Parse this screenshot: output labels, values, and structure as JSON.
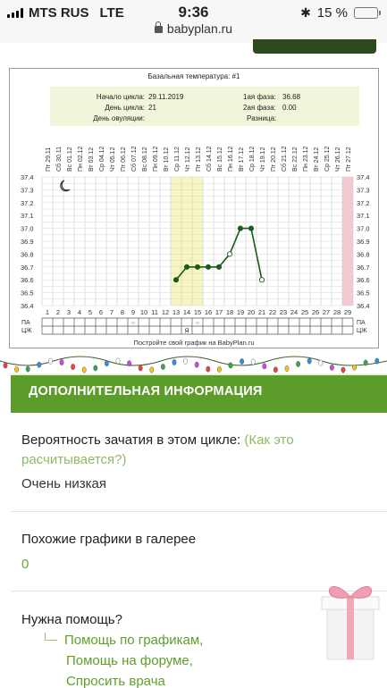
{
  "status_bar": {
    "carrier": "MTS RUS",
    "network": "LTE",
    "time": "9:36",
    "battery": "15 %",
    "battery_level": 0.15,
    "url": "babyplan.ru"
  },
  "chart_data": {
    "type": "line",
    "title": "Базальная температура: #1",
    "info": {
      "cycle_start_label": "Начало цикла:",
      "cycle_start": "29.11.2019",
      "cycle_day_label": "День цикла:",
      "cycle_day": "21",
      "ovulation_day_label": "День овуляции:",
      "ovulation_day": "",
      "phase1_label": "1ая фаза:",
      "phase1": "36.68",
      "phase2_label": "2ая фаза:",
      "phase2": "0.00",
      "difference_label": "Разница:",
      "difference": ""
    },
    "dates": [
      "Пт 29.11",
      "Сб 30.11",
      "Вс 01.12",
      "Пн 02.12",
      "Вт 03.12",
      "Ср 04.12",
      "Чт 05.12",
      "Пт 06.12",
      "Сб 07.12",
      "Вс 08.12",
      "Пн 09.12",
      "Вт 10.12",
      "Ср 11.12",
      "Чт 12.12",
      "Пт 13.12",
      "Сб 14.12",
      "Вс 15.12",
      "Пн 16.12",
      "Вт 17.12",
      "Ср 18.12",
      "Чт 19.12",
      "Пт 20.12",
      "Сб 21.12",
      "Вс 22.12",
      "Пн 23.12",
      "Вт 24.12",
      "Ср 25.12",
      "Чт 26.12",
      "Пт 27.12"
    ],
    "days": [
      1,
      2,
      3,
      4,
      5,
      6,
      7,
      8,
      9,
      10,
      11,
      12,
      13,
      14,
      15,
      16,
      17,
      18,
      19,
      20,
      21,
      22,
      23,
      24,
      25,
      26,
      27,
      28,
      29
    ],
    "y_ticks": [
      "37.4",
      "37.3",
      "37.2",
      "37.1",
      "37.0",
      "36.9",
      "36.8",
      "36.7",
      "36.6",
      "36.5",
      "36.4"
    ],
    "ylim": [
      36.4,
      37.4
    ],
    "series": [
      {
        "x": [
          13,
          14,
          15,
          16,
          17,
          18,
          19,
          20,
          21
        ],
        "values": [
          36.6,
          36.7,
          36.7,
          36.7,
          36.7,
          36.8,
          37.0,
          37.0,
          36.6
        ],
        "hollow": [
          false,
          false,
          false,
          false,
          false,
          true,
          false,
          false,
          true
        ]
      }
    ],
    "highlight_days": [
      13,
      14,
      15
    ],
    "highlight_color": "#f8f6c0",
    "end_day": 29,
    "end_color": "#f6c8cf",
    "pa_label": "ПА",
    "cj_label": "ЦЖ",
    "pa_marks": [
      {
        "day": 9,
        "mark": "○"
      },
      {
        "day": 15,
        "mark": "○"
      }
    ],
    "cj_marks": [
      {
        "day": 14,
        "mark": "Я"
      }
    ],
    "footer": "Постройте свой график на BabyPlan.ru",
    "line_color": "#1a5a1a"
  },
  "section": {
    "title": "ДОПОЛНИТЕЛЬНАЯ ИНФОРМАЦИЯ"
  },
  "probability": {
    "label": "Вероятность зачатия в этом цикле:",
    "link": "(Как это расчитывается?)",
    "value": "Очень низкая"
  },
  "similar": {
    "label": "Похожие графики в галерее",
    "value": "0"
  },
  "help": {
    "label": "Нужна помощь?",
    "links": [
      "Помощь по графикам,",
      "Помощь на форуме,",
      "Спросить врача"
    ]
  },
  "colors": {
    "accent_green": "#5b9c2b",
    "link_green": "#8fba63"
  }
}
